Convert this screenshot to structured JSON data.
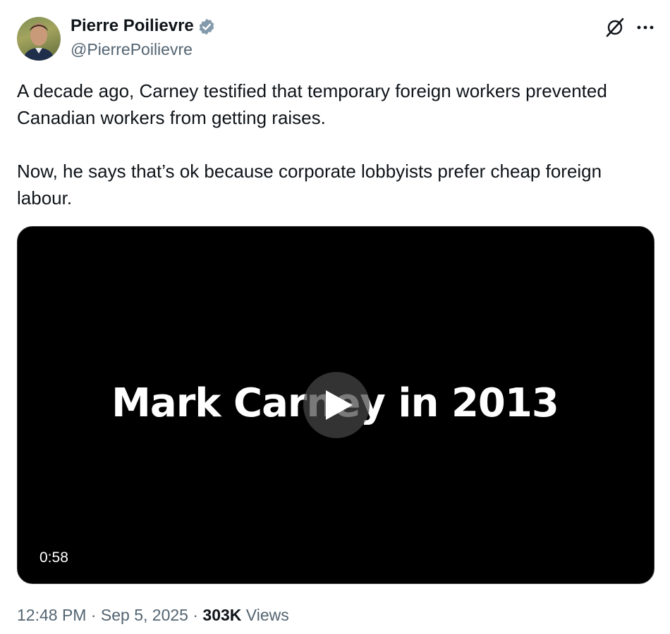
{
  "author": {
    "display_name": "Pierre Poilievre",
    "handle": "@PierrePoilievre",
    "verified": true,
    "verified_color": "#829aab"
  },
  "header_icons": [
    "grok-icon",
    "more-icon"
  ],
  "tweet": {
    "paragraphs": [
      "A decade ago, Carney testified that temporary foreign workers prevented Canadian workers from getting raises.",
      "Now, he says that’s ok because corporate lobbyists prefer cheap foreign labour."
    ]
  },
  "video": {
    "overlay_text": "Mark Carney in 2013",
    "duration": "0:58"
  },
  "meta": {
    "time": "12:48 PM",
    "separator": "·",
    "date": "Sep 5, 2025",
    "views_count": "303K",
    "views_label": "Views"
  }
}
